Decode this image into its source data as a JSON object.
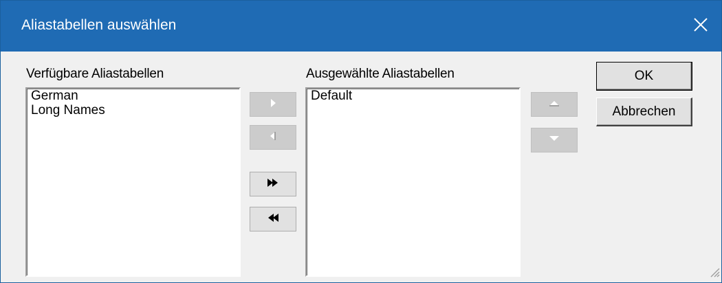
{
  "window": {
    "title": "Aliastabellen auswählen"
  },
  "available": {
    "label": "Verfügbare Aliastabellen",
    "items": [
      "German",
      "Long Names"
    ]
  },
  "selected": {
    "label": "Ausgewählte Aliastabellen",
    "items": [
      "Default"
    ]
  },
  "buttons": {
    "ok": "OK",
    "cancel": "Abbrechen"
  },
  "icons": {
    "close": "close-icon",
    "add": "arrow-right-icon",
    "remove": "arrow-left-icon",
    "add_all": "double-arrow-right-icon",
    "remove_all": "double-arrow-left-icon",
    "move_up": "arrow-up-icon",
    "move_down": "arrow-down-icon",
    "resize": "resize-grip-icon"
  },
  "colors": {
    "titlebar": "#1f6bb4",
    "dialog_bg": "#f0f0f0",
    "disabled_glyph": "#a0a0a0"
  }
}
